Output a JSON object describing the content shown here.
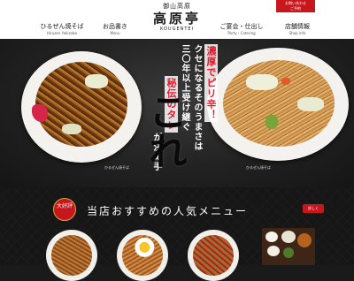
{
  "header": {
    "logo_sub": "御山高原",
    "logo_main": "高原亭",
    "logo_en": "KOUGENTEI",
    "nav": [
      {
        "jp": "ひるぜん焼そば",
        "en": "Hiruzen Yakisoba"
      },
      {
        "jp": "お品書き",
        "en": "Menu"
      },
      {
        "jp": "ご宴会・仕出し",
        "en": "Party・Catering"
      },
      {
        "jp": "店舗情報",
        "en": "Shop info"
      }
    ],
    "contact_line1": "お問い合わせ",
    "contact_line2": "ご予約"
  },
  "hero": {
    "tag_red": "濃厚でピリ辛！",
    "tag_line2": "クセになるそのうまさは",
    "tag_line3": "三〇年以上受け継ぐ",
    "tag_red2": "秘伝のタレ",
    "tag_end": "が決め手",
    "brush": "これ",
    "caption_left": "ひるぜん焼そば",
    "caption_right": "ひるぜん焼そば"
  },
  "recommend": {
    "badge": "大好評",
    "title": "当店おすすめの人気メニュー",
    "more_label": "詳しく"
  },
  "colors": {
    "accent_red": "#c8161d",
    "gold": "#d9a441"
  }
}
